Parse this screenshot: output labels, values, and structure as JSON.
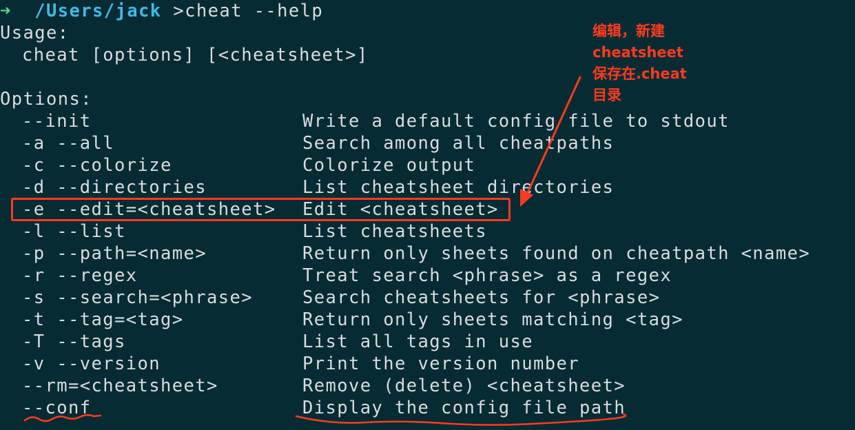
{
  "prompt": {
    "arrow": "➜",
    "path": "/Users/jack",
    "command": ">cheat --help"
  },
  "usage": {
    "label": "Usage:",
    "text": "cheat [options] [<cheatsheet>]"
  },
  "options_label": "Options:",
  "options": [
    {
      "flag": "--init",
      "desc": "Write a default config file to stdout"
    },
    {
      "flag": "-a --all",
      "desc": "Search among all cheatpaths"
    },
    {
      "flag": "-c --colorize",
      "desc": "Colorize output"
    },
    {
      "flag": "-d --directories",
      "desc": "List cheatsheet directories"
    },
    {
      "flag": "-e --edit=<cheatsheet>",
      "desc": "Edit <cheatsheet>"
    },
    {
      "flag": "-l --list",
      "desc": "List cheatsheets"
    },
    {
      "flag": "-p --path=<name>",
      "desc": "Return only sheets found on cheatpath <name>"
    },
    {
      "flag": "-r --regex",
      "desc": "Treat search <phrase> as a regex"
    },
    {
      "flag": "-s --search=<phrase>",
      "desc": "Search cheatsheets for <phrase>"
    },
    {
      "flag": "-t --tag=<tag>",
      "desc": "Return only sheets matching <tag>"
    },
    {
      "flag": "-T --tags",
      "desc": "List all tags in use"
    },
    {
      "flag": "-v --version",
      "desc": "Print the version number"
    },
    {
      "flag": "--rm=<cheatsheet>",
      "desc": "Remove (delete) <cheatsheet>"
    },
    {
      "flag": "--conf",
      "desc": "Display the config file path"
    }
  ],
  "annotation": {
    "lines": [
      "编辑，新建",
      "cheatsheet",
      "保存在.cheat",
      "目录"
    ]
  },
  "colors": {
    "background": "#062b33",
    "text": "#d7dde0",
    "prompt_arrow": "#5fd38d",
    "prompt_path": "#41b9e6",
    "annotation": "#ff3b1f"
  }
}
